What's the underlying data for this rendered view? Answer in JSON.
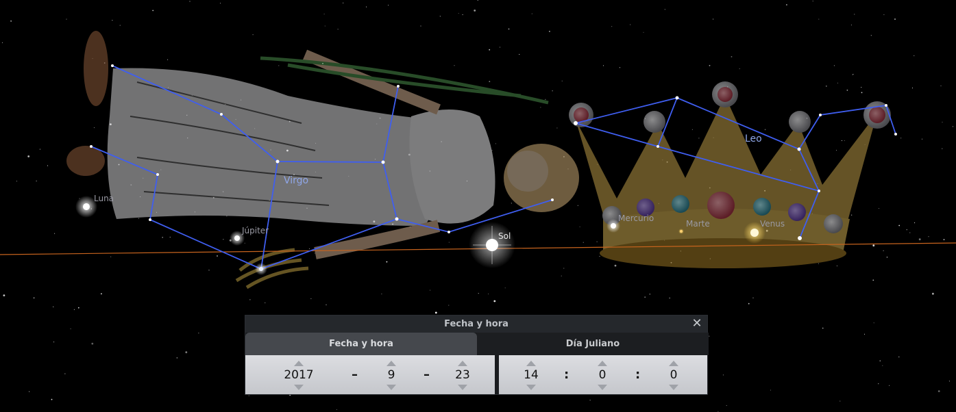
{
  "sky": {
    "constellations": [
      "Virgo",
      "Leo"
    ],
    "planets": [
      "Luna",
      "Júpiter",
      "Sol",
      "Mercurio",
      "Marte",
      "Venus"
    ],
    "line_color": "#3f5ef0",
    "horizon_color": "#c8641e"
  },
  "dialog": {
    "title": "Fecha y hora",
    "close_symbol": "✕",
    "tabs": [
      "Fecha y hora",
      "Día Juliano"
    ],
    "active_tab": "Fecha y hora",
    "date": {
      "year": "2017",
      "month": "9",
      "day": "23",
      "separator": "–"
    },
    "time": {
      "hour": "14",
      "minute": "0",
      "second": "0",
      "separator": ":"
    }
  }
}
